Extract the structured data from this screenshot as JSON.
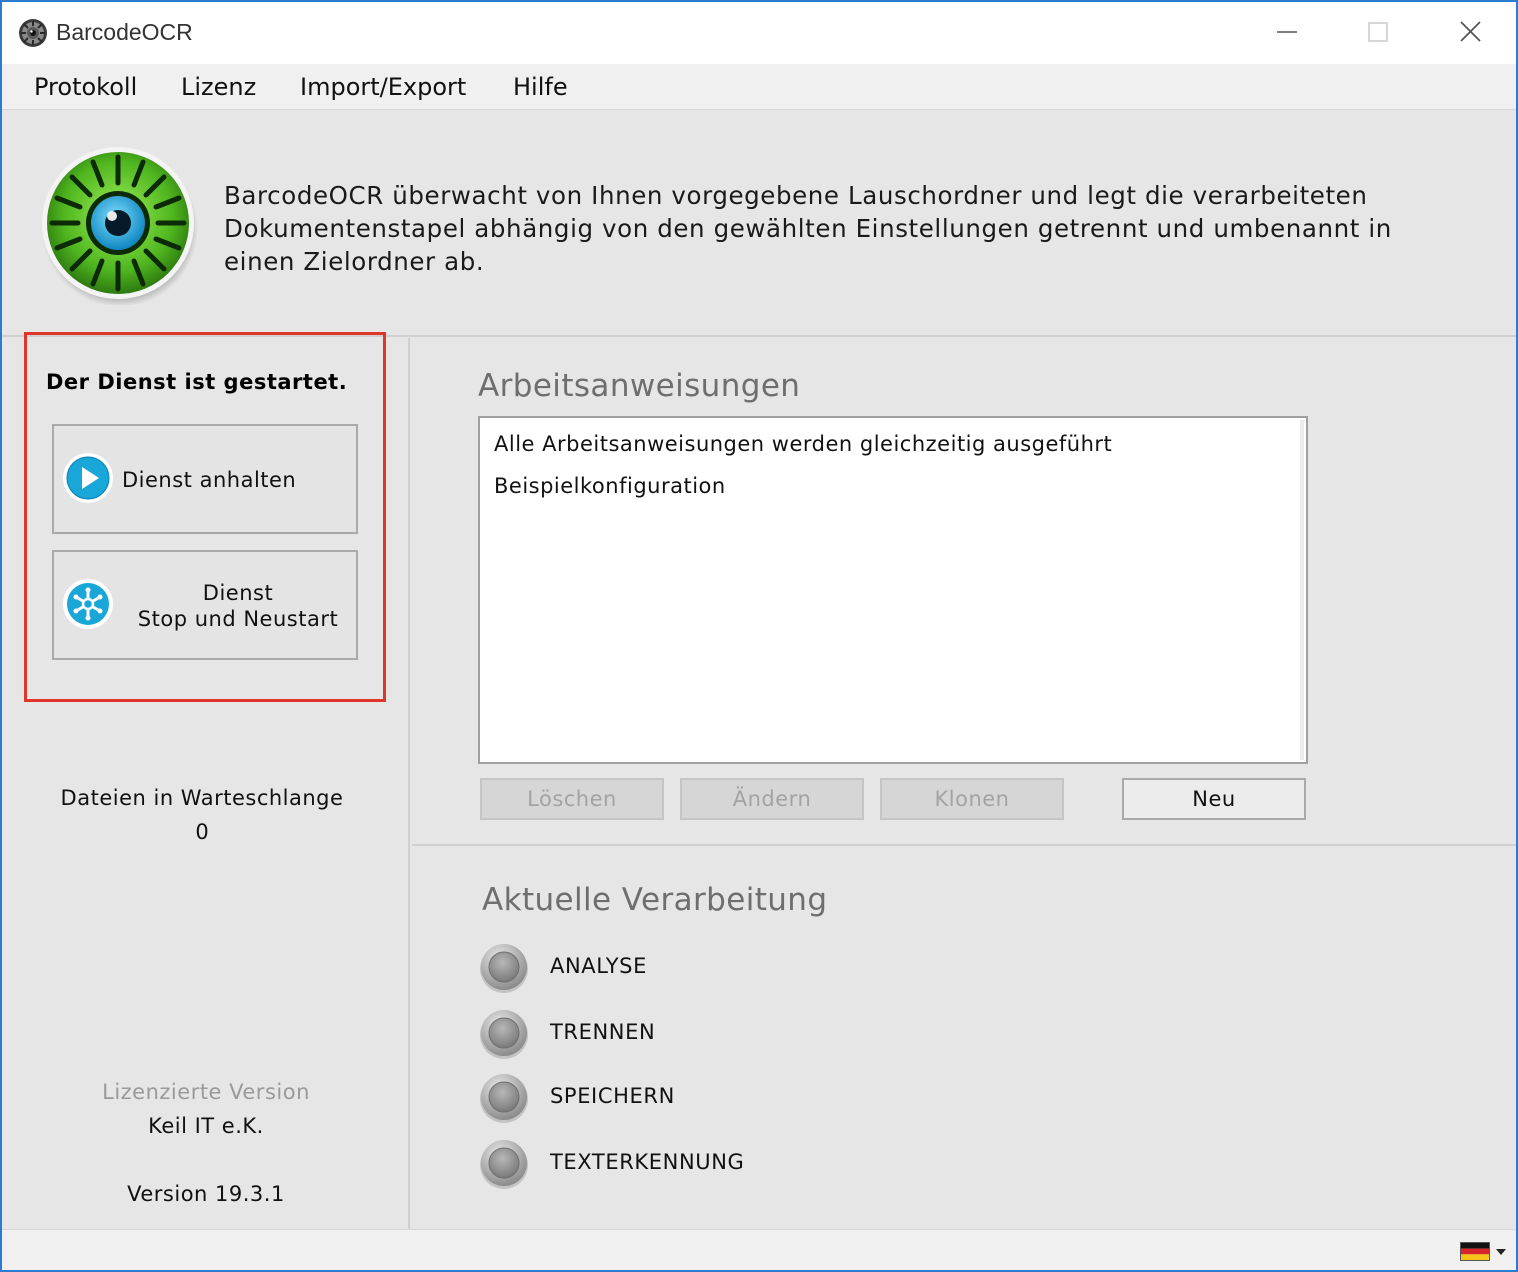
{
  "window": {
    "title": "BarcodeOCR"
  },
  "menu": {
    "items": [
      {
        "label": "Protokoll"
      },
      {
        "label": "Lizenz"
      },
      {
        "label": "Import/Export"
      },
      {
        "label": "Hilfe"
      }
    ]
  },
  "header": {
    "description": "BarcodeOCR überwacht von Ihnen vorgegebene Lauschordner und legt die verarbeiteten Dokumentenstapel abhängig von den gewählten Einstellungen getrennt und umbenannt in einen Zielordner ab.",
    "logo_icon": "eye-logo-icon"
  },
  "service": {
    "status": "Der Dienst ist gestartet.",
    "stop_button": {
      "label": "Dienst anhalten",
      "icon": "play-icon"
    },
    "restart_button": {
      "label_line1": "Dienst",
      "label_line2": "Stop und Neustart",
      "icon": "snowflake-restart-icon"
    },
    "queue_label": "Dateien in Warteschlange",
    "queue_count": "0",
    "license_label": "Lizenzierte Version",
    "license_owner": "Keil IT e.K.",
    "version": "Version 19.3.1"
  },
  "work_instructions": {
    "title": "Arbeitsanweisungen",
    "items": [
      "Alle Arbeitsanweisungen werden gleichzeitig ausgeführt",
      "Beispielkonfiguration"
    ],
    "buttons": {
      "delete": "Löschen",
      "edit": "Ändern",
      "clone": "Klonen",
      "new": "Neu"
    }
  },
  "processing": {
    "title": "Aktuelle Verarbeitung",
    "steps": [
      {
        "label": "ANALYSE",
        "active": false
      },
      {
        "label": "TRENNEN",
        "active": false
      },
      {
        "label": "SPEICHERN",
        "active": false
      },
      {
        "label": "TEXTERKENNUNG",
        "active": false
      }
    ]
  },
  "statusbar": {
    "language_flag": "german-flag-icon"
  },
  "colors": {
    "accent": "#1aa3d4",
    "highlight_border": "#e0352b",
    "logo_green": "#5cc22e",
    "window_border": "#2b7bd1"
  }
}
